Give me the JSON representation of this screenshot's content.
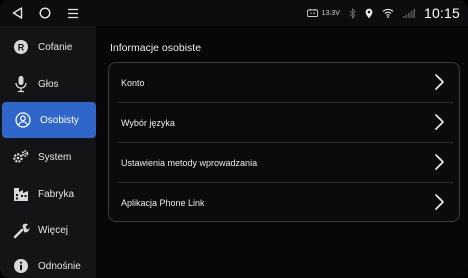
{
  "statusbar": {
    "battery_voltage": "13.3V",
    "time": "10:15"
  },
  "sidebar": {
    "items": [
      {
        "label": "Cofanie"
      },
      {
        "label": "Głos"
      },
      {
        "label": "Osobisty",
        "active": true
      },
      {
        "label": "System"
      },
      {
        "label": "Fabryka"
      },
      {
        "label": "Więcej"
      },
      {
        "label": "Odnośnie"
      }
    ]
  },
  "main": {
    "title": "Informacje osobiste",
    "rows": [
      {
        "label": "Konto"
      },
      {
        "label": "Wybór języka"
      },
      {
        "label": "Ustawienia metody wprowadzania"
      },
      {
        "label": "Aplikacja Phone Link"
      }
    ]
  },
  "colors": {
    "accent": "#2f66c9",
    "background": "#000000",
    "sidebar": "#141416"
  }
}
